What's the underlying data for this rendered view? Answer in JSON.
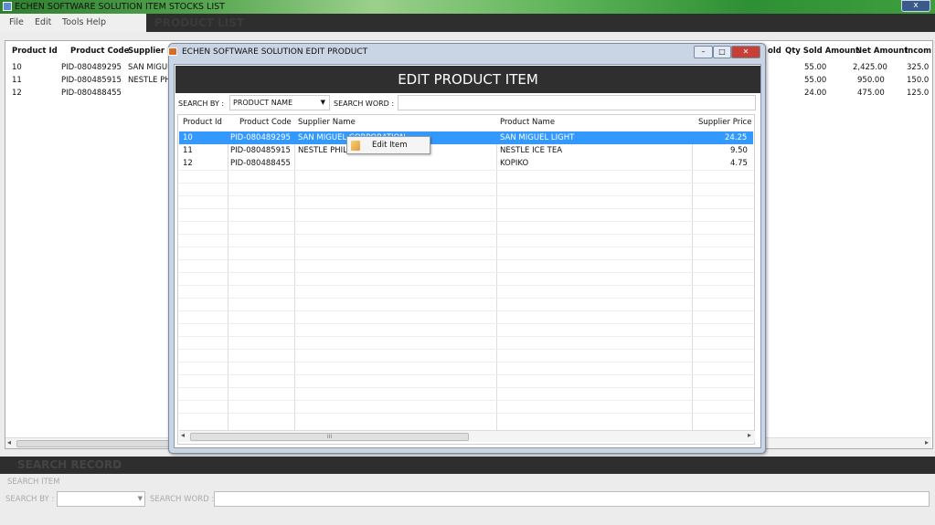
{
  "window": {
    "title": "ECHEN SOFTWARE SOLUTION ITEM STOCKS LIST",
    "close": "x"
  },
  "menu": {
    "file": "File",
    "edit": "Edit",
    "tools": "Tools Help"
  },
  "header": {
    "title": "PRODUCT LIST"
  },
  "background_table": {
    "columns_left": [
      "Product Id",
      "Product Code",
      "Supplier Na"
    ],
    "columns_right": [
      "old",
      "Qty Sold Amount",
      "Net Amount",
      "Incom"
    ],
    "rows": [
      {
        "id": "10",
        "code": "PID-080489295",
        "supplier": "SAN MIGUE",
        "qty_sold": "55.00",
        "net": "2,425.00",
        "income": "325.0"
      },
      {
        "id": "11",
        "code": "PID-080485915",
        "supplier": "NESTLE PHI",
        "qty_sold": "55.00",
        "net": "950.00",
        "income": "150.0"
      },
      {
        "id": "12",
        "code": "PID-080488455",
        "supplier": "",
        "qty_sold": "24.00",
        "net": "475.00",
        "income": "125.0"
      }
    ]
  },
  "search": {
    "header": "SEARCH RECORD",
    "item_label": "SEARCH ITEM",
    "by_label": "SEARCH BY :",
    "word_label": "SEARCH WORD :",
    "by_value": "",
    "word_value": ""
  },
  "dialog": {
    "title": "ECHEN SOFTWARE SOLUTION EDIT PRODUCT",
    "header": "EDIT PRODUCT ITEM",
    "search_by_label": "SEARCH BY :",
    "search_by_value": "PRODUCT NAME",
    "search_word_label": "SEARCH WORD :",
    "search_word_value": "",
    "grid": {
      "columns": [
        "Product Id",
        "Product Code",
        "Supplier Name",
        "Product Name",
        "Supplier Price"
      ],
      "rows": [
        {
          "id": "10",
          "code": "PID-080489295",
          "supplier": "SAN MIGUEL CORPORATION",
          "name": "SAN MIGUEL LIGHT",
          "price": "24.25",
          "selected": true
        },
        {
          "id": "11",
          "code": "PID-080485915",
          "supplier": "NESTLE PHILIP",
          "name": "NESTLE ICE TEA",
          "price": "9.50",
          "selected": false
        },
        {
          "id": "12",
          "code": "PID-080488455",
          "supplier": "",
          "name": "KOPIKO",
          "price": "4.75",
          "selected": false
        }
      ]
    },
    "scroll_thumb": "III",
    "context_menu": {
      "item": "Edit Item"
    }
  }
}
